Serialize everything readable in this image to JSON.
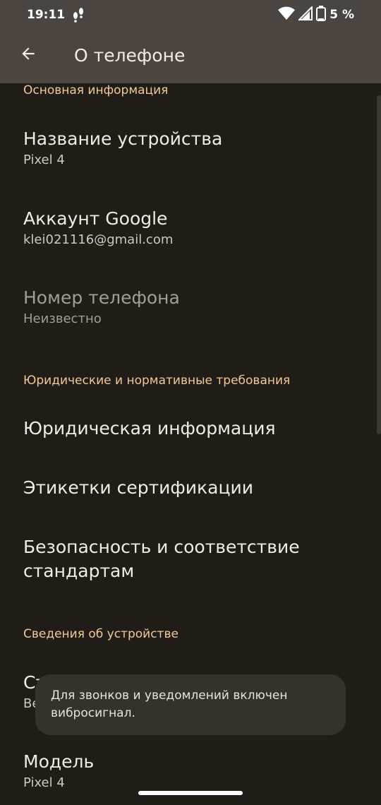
{
  "status_bar": {
    "time": "19:11",
    "battery_percent": "5 %",
    "icons": [
      "notification-icon",
      "wifi-icon",
      "signal-icon",
      "battery-icon"
    ]
  },
  "app_bar": {
    "title": "О телефоне",
    "back_icon": "arrow-back-icon"
  },
  "sections": {
    "basic": {
      "header": "Основная информация",
      "device_name": {
        "title": "Название устройства",
        "value": "Pixel 4"
      },
      "google_account": {
        "title": "Аккаунт Google",
        "value": "klei021116@gmail.com"
      },
      "phone_number": {
        "title": "Номер телефона",
        "value": "Неизвестно"
      }
    },
    "legal": {
      "header": "Юридические и нормативные требования",
      "legal_info": "Юридическая информация",
      "certification_labels": "Этикетки сертификации",
      "safety_line1": "Безопасность и соответствие",
      "safety_line2": "стандартам"
    },
    "device": {
      "header": "Сведения об устройстве",
      "partial_title": "Ст",
      "partial_value": "Ве",
      "model": {
        "title": "Модель",
        "value": "Pixel 4"
      }
    }
  },
  "toast": {
    "line1": "Для звонков и уведомлений включен",
    "line2": "вибросигнал."
  },
  "colors": {
    "background": "#201c18",
    "app_bar": "#4a4540",
    "accent": "#f1c89a",
    "toast": "#35312c"
  }
}
